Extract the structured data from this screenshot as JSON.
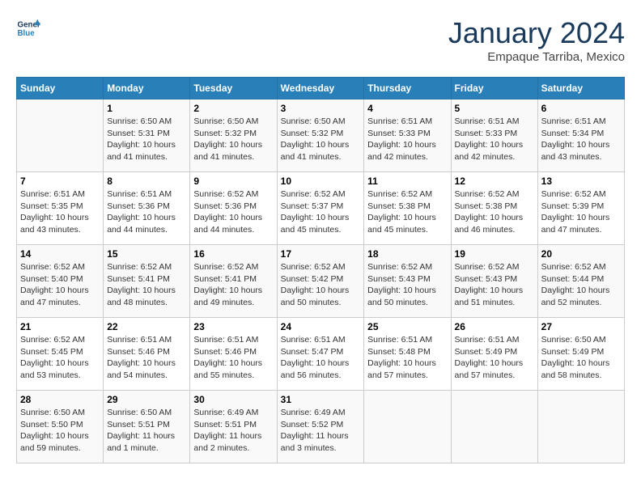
{
  "header": {
    "logo_line1": "General",
    "logo_line2": "Blue",
    "month": "January 2024",
    "location": "Empaque Tarriba, Mexico"
  },
  "weekdays": [
    "Sunday",
    "Monday",
    "Tuesday",
    "Wednesday",
    "Thursday",
    "Friday",
    "Saturday"
  ],
  "weeks": [
    [
      {
        "day": "",
        "sunrise": "",
        "sunset": "",
        "daylight": ""
      },
      {
        "day": "1",
        "sunrise": "Sunrise: 6:50 AM",
        "sunset": "Sunset: 5:31 PM",
        "daylight": "Daylight: 10 hours and 41 minutes."
      },
      {
        "day": "2",
        "sunrise": "Sunrise: 6:50 AM",
        "sunset": "Sunset: 5:32 PM",
        "daylight": "Daylight: 10 hours and 41 minutes."
      },
      {
        "day": "3",
        "sunrise": "Sunrise: 6:50 AM",
        "sunset": "Sunset: 5:32 PM",
        "daylight": "Daylight: 10 hours and 41 minutes."
      },
      {
        "day": "4",
        "sunrise": "Sunrise: 6:51 AM",
        "sunset": "Sunset: 5:33 PM",
        "daylight": "Daylight: 10 hours and 42 minutes."
      },
      {
        "day": "5",
        "sunrise": "Sunrise: 6:51 AM",
        "sunset": "Sunset: 5:33 PM",
        "daylight": "Daylight: 10 hours and 42 minutes."
      },
      {
        "day": "6",
        "sunrise": "Sunrise: 6:51 AM",
        "sunset": "Sunset: 5:34 PM",
        "daylight": "Daylight: 10 hours and 43 minutes."
      }
    ],
    [
      {
        "day": "7",
        "sunrise": "Sunrise: 6:51 AM",
        "sunset": "Sunset: 5:35 PM",
        "daylight": "Daylight: 10 hours and 43 minutes."
      },
      {
        "day": "8",
        "sunrise": "Sunrise: 6:51 AM",
        "sunset": "Sunset: 5:36 PM",
        "daylight": "Daylight: 10 hours and 44 minutes."
      },
      {
        "day": "9",
        "sunrise": "Sunrise: 6:52 AM",
        "sunset": "Sunset: 5:36 PM",
        "daylight": "Daylight: 10 hours and 44 minutes."
      },
      {
        "day": "10",
        "sunrise": "Sunrise: 6:52 AM",
        "sunset": "Sunset: 5:37 PM",
        "daylight": "Daylight: 10 hours and 45 minutes."
      },
      {
        "day": "11",
        "sunrise": "Sunrise: 6:52 AM",
        "sunset": "Sunset: 5:38 PM",
        "daylight": "Daylight: 10 hours and 45 minutes."
      },
      {
        "day": "12",
        "sunrise": "Sunrise: 6:52 AM",
        "sunset": "Sunset: 5:38 PM",
        "daylight": "Daylight: 10 hours and 46 minutes."
      },
      {
        "day": "13",
        "sunrise": "Sunrise: 6:52 AM",
        "sunset": "Sunset: 5:39 PM",
        "daylight": "Daylight: 10 hours and 47 minutes."
      }
    ],
    [
      {
        "day": "14",
        "sunrise": "Sunrise: 6:52 AM",
        "sunset": "Sunset: 5:40 PM",
        "daylight": "Daylight: 10 hours and 47 minutes."
      },
      {
        "day": "15",
        "sunrise": "Sunrise: 6:52 AM",
        "sunset": "Sunset: 5:41 PM",
        "daylight": "Daylight: 10 hours and 48 minutes."
      },
      {
        "day": "16",
        "sunrise": "Sunrise: 6:52 AM",
        "sunset": "Sunset: 5:41 PM",
        "daylight": "Daylight: 10 hours and 49 minutes."
      },
      {
        "day": "17",
        "sunrise": "Sunrise: 6:52 AM",
        "sunset": "Sunset: 5:42 PM",
        "daylight": "Daylight: 10 hours and 50 minutes."
      },
      {
        "day": "18",
        "sunrise": "Sunrise: 6:52 AM",
        "sunset": "Sunset: 5:43 PM",
        "daylight": "Daylight: 10 hours and 50 minutes."
      },
      {
        "day": "19",
        "sunrise": "Sunrise: 6:52 AM",
        "sunset": "Sunset: 5:43 PM",
        "daylight": "Daylight: 10 hours and 51 minutes."
      },
      {
        "day": "20",
        "sunrise": "Sunrise: 6:52 AM",
        "sunset": "Sunset: 5:44 PM",
        "daylight": "Daylight: 10 hours and 52 minutes."
      }
    ],
    [
      {
        "day": "21",
        "sunrise": "Sunrise: 6:52 AM",
        "sunset": "Sunset: 5:45 PM",
        "daylight": "Daylight: 10 hours and 53 minutes."
      },
      {
        "day": "22",
        "sunrise": "Sunrise: 6:51 AM",
        "sunset": "Sunset: 5:46 PM",
        "daylight": "Daylight: 10 hours and 54 minutes."
      },
      {
        "day": "23",
        "sunrise": "Sunrise: 6:51 AM",
        "sunset": "Sunset: 5:46 PM",
        "daylight": "Daylight: 10 hours and 55 minutes."
      },
      {
        "day": "24",
        "sunrise": "Sunrise: 6:51 AM",
        "sunset": "Sunset: 5:47 PM",
        "daylight": "Daylight: 10 hours and 56 minutes."
      },
      {
        "day": "25",
        "sunrise": "Sunrise: 6:51 AM",
        "sunset": "Sunset: 5:48 PM",
        "daylight": "Daylight: 10 hours and 57 minutes."
      },
      {
        "day": "26",
        "sunrise": "Sunrise: 6:51 AM",
        "sunset": "Sunset: 5:49 PM",
        "daylight": "Daylight: 10 hours and 57 minutes."
      },
      {
        "day": "27",
        "sunrise": "Sunrise: 6:50 AM",
        "sunset": "Sunset: 5:49 PM",
        "daylight": "Daylight: 10 hours and 58 minutes."
      }
    ],
    [
      {
        "day": "28",
        "sunrise": "Sunrise: 6:50 AM",
        "sunset": "Sunset: 5:50 PM",
        "daylight": "Daylight: 10 hours and 59 minutes."
      },
      {
        "day": "29",
        "sunrise": "Sunrise: 6:50 AM",
        "sunset": "Sunset: 5:51 PM",
        "daylight": "Daylight: 11 hours and 1 minute."
      },
      {
        "day": "30",
        "sunrise": "Sunrise: 6:49 AM",
        "sunset": "Sunset: 5:51 PM",
        "daylight": "Daylight: 11 hours and 2 minutes."
      },
      {
        "day": "31",
        "sunrise": "Sunrise: 6:49 AM",
        "sunset": "Sunset: 5:52 PM",
        "daylight": "Daylight: 11 hours and 3 minutes."
      },
      {
        "day": "",
        "sunrise": "",
        "sunset": "",
        "daylight": ""
      },
      {
        "day": "",
        "sunrise": "",
        "sunset": "",
        "daylight": ""
      },
      {
        "day": "",
        "sunrise": "",
        "sunset": "",
        "daylight": ""
      }
    ]
  ]
}
